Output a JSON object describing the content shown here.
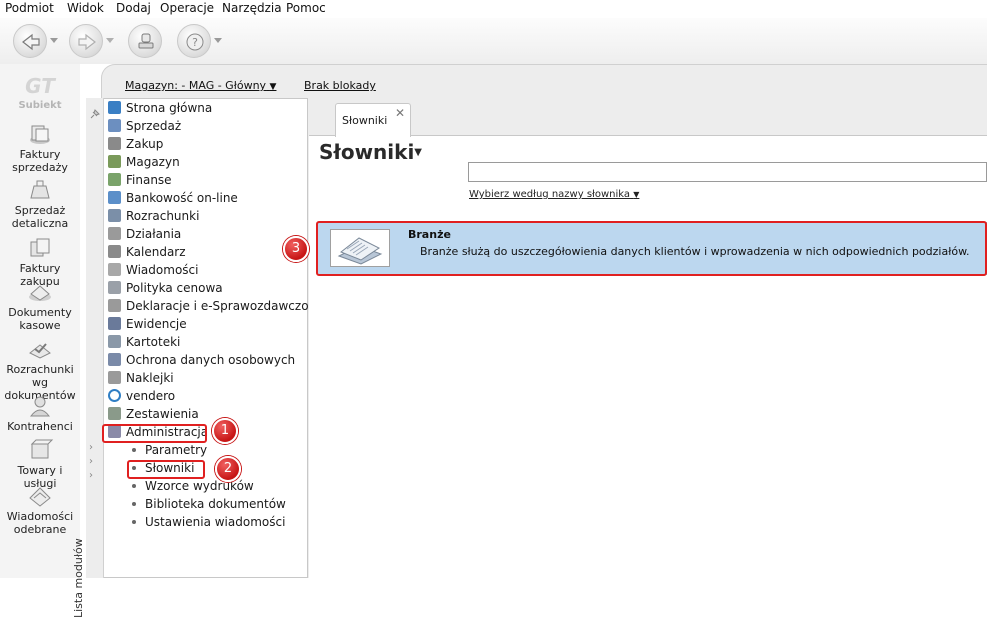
{
  "menu": [
    "Podmiot",
    "Widok",
    "Dodaj",
    "Operacje",
    "Narzędzia",
    "Pomoc"
  ],
  "brand": {
    "name": "Subiekt"
  },
  "left_nav": [
    {
      "label": "Faktury sprzedaży",
      "icon": "invoice-icon"
    },
    {
      "label": "Sprzedaż detaliczna",
      "icon": "cash-register-icon"
    },
    {
      "label": "Faktury zakupu",
      "icon": "purchase-invoice-icon"
    },
    {
      "label": "Dokumenty kasowe",
      "icon": "cash-documents-icon"
    },
    {
      "label": "Rozrachunki wg dokumentów",
      "icon": "settlements-icon"
    },
    {
      "label": "Kontrahenci",
      "icon": "contractor-icon"
    },
    {
      "label": "Towary i usługi",
      "icon": "goods-icon"
    },
    {
      "label": "Wiadomości odebrane",
      "icon": "inbox-icon"
    }
  ],
  "infobar": {
    "warehouse": "Magazyn: - MAG - Główny",
    "lock": "Brak blokady"
  },
  "modules_label": "Lista modułów",
  "modules": [
    {
      "label": "Strona główna",
      "color": "#3a7fc4"
    },
    {
      "label": "Sprzedaż",
      "color": "#6c8fc0"
    },
    {
      "label": "Zakup",
      "color": "#8a8a8a"
    },
    {
      "label": "Magazyn",
      "color": "#7a9a5a"
    },
    {
      "label": "Finanse",
      "color": "#7aa36a"
    },
    {
      "label": "Bankowość on-line",
      "color": "#5b8fc9"
    },
    {
      "label": "Rozrachunki",
      "color": "#7b8fa8"
    },
    {
      "label": "Działania",
      "color": "#9a9a9a"
    },
    {
      "label": "Kalendarz",
      "color": "#8a8a8a"
    },
    {
      "label": "Wiadomości",
      "color": "#a8a8a8"
    },
    {
      "label": "Polityka cenowa",
      "color": "#9aa0a8"
    },
    {
      "label": "Deklaracje i e-Sprawozdawczość",
      "color": "#9a9a9a"
    },
    {
      "label": "Ewidencje",
      "color": "#6a7a9a"
    },
    {
      "label": "Kartoteki",
      "color": "#8a98a8"
    },
    {
      "label": "Ochrona danych osobowych",
      "color": "#7a8aa8"
    },
    {
      "label": "Naklejki",
      "color": "#9a9a9a"
    },
    {
      "label": "vendero",
      "color": "#2f7ec4"
    },
    {
      "label": "Zestawienia",
      "color": "#8a9a8a"
    },
    {
      "label": "Administracja",
      "color": "#8a8aa8"
    }
  ],
  "submodules": [
    "Parametry",
    "Słowniki",
    "Wzorce wydruków",
    "Biblioteka dokumentów",
    "Ustawienia wiadomości"
  ],
  "tab": {
    "label": "Słowniki",
    "close": "✕"
  },
  "page": {
    "title": "Słowniki",
    "filter": "Wybierz według nazwy słownika",
    "search_value": ""
  },
  "dictionary": {
    "name": "Branże",
    "description": "Branże służą do uszczegółowienia danych klientów i wprowadzenia w nich odpowiednich podziałów."
  },
  "badges": [
    "1",
    "2",
    "3"
  ],
  "colors": {
    "highlight": "#e02020",
    "row_selected": "#bcd7ef",
    "badge": "#c71515"
  }
}
